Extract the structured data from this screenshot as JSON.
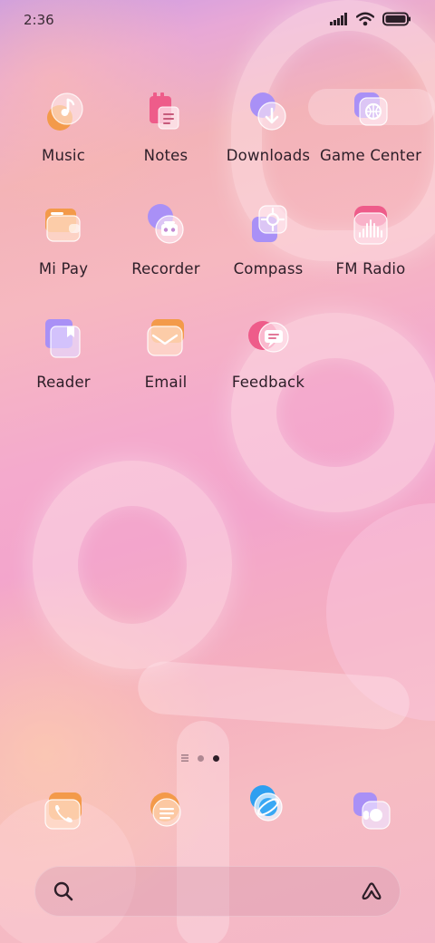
{
  "status_bar": {
    "time": "2:36",
    "icons": [
      "signal-icon",
      "wifi-icon",
      "battery-icon"
    ]
  },
  "apps": [
    {
      "label": "Music",
      "icon": "music-icon"
    },
    {
      "label": "Notes",
      "icon": "notes-icon"
    },
    {
      "label": "Downloads",
      "icon": "downloads-icon"
    },
    {
      "label": "Game Center",
      "icon": "game-center-icon"
    },
    {
      "label": "Mi Pay",
      "icon": "wallet-icon"
    },
    {
      "label": "Recorder",
      "icon": "recorder-icon"
    },
    {
      "label": "Compass",
      "icon": "compass-icon"
    },
    {
      "label": "FM Radio",
      "icon": "radio-icon"
    },
    {
      "label": "Reader",
      "icon": "book-icon"
    },
    {
      "label": "Email",
      "icon": "email-icon"
    },
    {
      "label": "Feedback",
      "icon": "feedback-icon"
    }
  ],
  "page_indicator": {
    "pages": [
      "list",
      "page",
      "page"
    ],
    "active_index": 2
  },
  "dock": [
    {
      "icon": "phone-icon"
    },
    {
      "icon": "messages-icon"
    },
    {
      "icon": "browser-icon"
    },
    {
      "icon": "gallery-icon"
    }
  ],
  "search_bar": {
    "icons": [
      "search-icon",
      "assistant-icon"
    ]
  },
  "colors": {
    "accent_orange": "#f39a4a",
    "accent_purple": "#a990f6",
    "accent_pink": "#ee5c8a",
    "label": "#2d1e28"
  }
}
